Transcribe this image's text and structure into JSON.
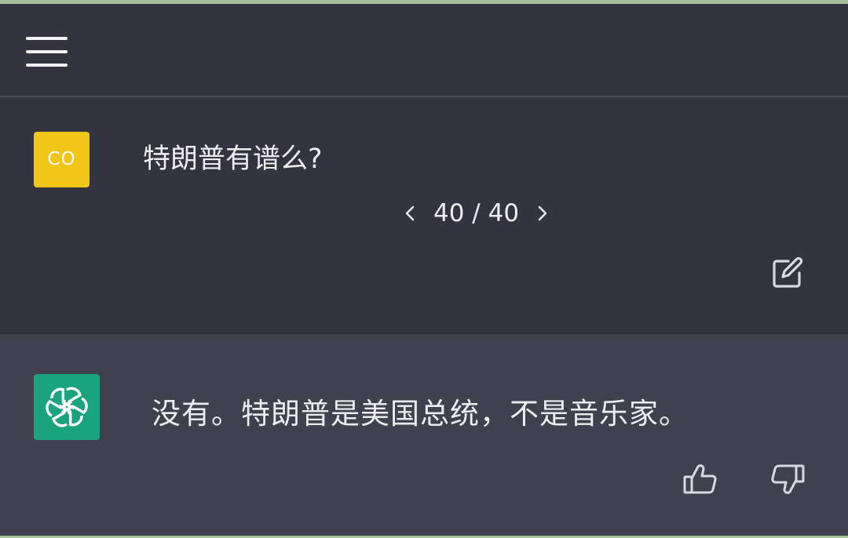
{
  "header": {
    "menu_icon": "hamburger-menu-icon"
  },
  "conversation": {
    "user": {
      "avatar_initials": "CO",
      "avatar_color": "#f2c616",
      "message": "特朗普有谱么?",
      "pager": {
        "current": 40,
        "total": 40,
        "label": "40 / 40"
      },
      "edit_icon": "edit-icon"
    },
    "assistant": {
      "avatar_icon": "openai-logo-icon",
      "avatar_color": "#19a37e",
      "message": "没有。特朗普是美国总统，不是音乐家。",
      "feedback": {
        "thumbs_up_icon": "thumbs-up-icon",
        "thumbs_down_icon": "thumbs-down-icon"
      }
    }
  },
  "colors": {
    "background": "#33343f",
    "assistant_background": "#40414e",
    "text": "#ececf1"
  }
}
